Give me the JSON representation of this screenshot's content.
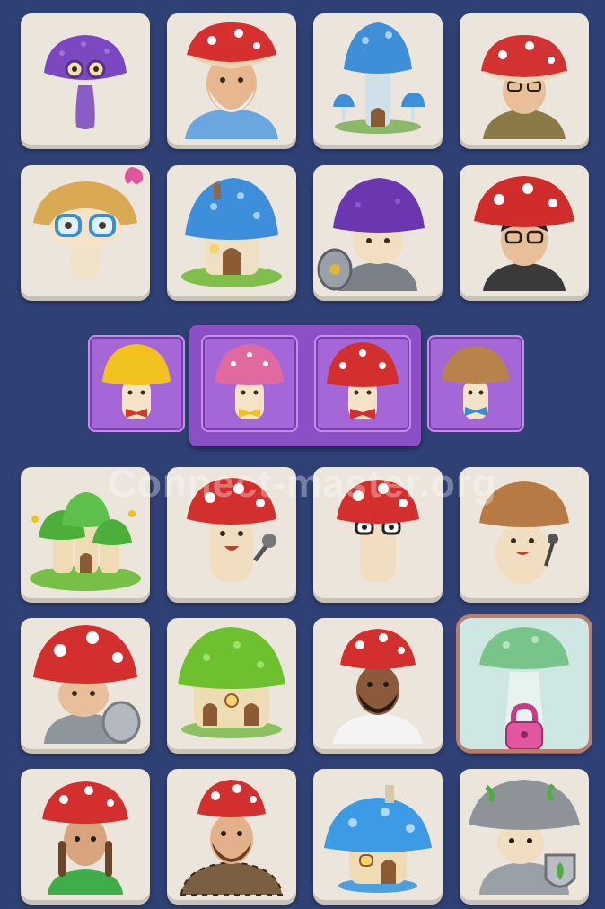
{
  "watermark": "Connect-master.org",
  "tiles": [
    {
      "name": "tile-purple-mushroom-glasses",
      "icon": "purple-mushroom-glasses-icon",
      "locked": false
    },
    {
      "name": "tile-old-man-red-cap",
      "icon": "old-man-red-cap-icon",
      "locked": false
    },
    {
      "name": "tile-blue-mushroom-tower",
      "icon": "blue-mushroom-tower-icon",
      "locked": false
    },
    {
      "name": "tile-man-glasses-red-cap",
      "icon": "man-glasses-red-cap-icon",
      "locked": false
    },
    {
      "name": "tile-tan-mushroom-blue-glasses",
      "icon": "tan-mushroom-blue-glasses-icon",
      "locked": false
    },
    {
      "name": "tile-blue-mushroom-house",
      "icon": "blue-mushroom-house-icon",
      "locked": false
    },
    {
      "name": "tile-purple-knight-mushroom",
      "icon": "purple-knight-mushroom-icon",
      "locked": false
    },
    {
      "name": "tile-man-glasses-red-cap-2",
      "icon": "man-glasses-red-cap-icon",
      "locked": false
    },
    {
      "name": "tile-green-mushroom-village",
      "icon": "green-mushroom-village-icon",
      "locked": false
    },
    {
      "name": "tile-red-mushroom-singer",
      "icon": "red-mushroom-singer-icon",
      "locked": false
    },
    {
      "name": "tile-red-mushroom-glasses",
      "icon": "red-mushroom-glasses-icon",
      "locked": false
    },
    {
      "name": "tile-tan-mushroom-singer",
      "icon": "tan-mushroom-singer-icon",
      "locked": false
    },
    {
      "name": "tile-red-knight-mushroom",
      "icon": "red-knight-mushroom-icon",
      "locked": false
    },
    {
      "name": "tile-green-mushroom-house",
      "icon": "green-mushroom-house-icon",
      "locked": false
    },
    {
      "name": "tile-bearded-man-red-cap",
      "icon": "bearded-man-red-cap-icon",
      "locked": false
    },
    {
      "name": "tile-ghost-mushroom-locked",
      "icon": "ghost-mushroom-icon",
      "locked": true
    },
    {
      "name": "tile-girl-braids-red-cap",
      "icon": "girl-braids-red-cap-icon",
      "locked": false
    },
    {
      "name": "tile-man-beard-plaid-red-cap",
      "icon": "man-beard-plaid-red-cap-icon",
      "locked": false
    },
    {
      "name": "tile-blue-mushroom-cottage",
      "icon": "blue-mushroom-cottage-icon",
      "locked": false
    },
    {
      "name": "tile-silver-knight-mushroom",
      "icon": "silver-knight-mushroom-icon",
      "locked": false
    }
  ],
  "selection": [
    {
      "name": "slot-yellow-mushroom",
      "icon": "yellow-mushroom-bowtie-icon"
    },
    {
      "name": "slot-pink-mushroom",
      "icon": "pink-mushroom-bowtie-icon"
    },
    {
      "name": "slot-red-mushroom",
      "icon": "red-mushroom-bowtie-icon"
    },
    {
      "name": "slot-brown-mushroom",
      "icon": "brown-mushroom-bowtie-icon"
    }
  ],
  "colors": {
    "background": "#2f4075",
    "tile": "#ebe5dc",
    "selection_bar": "#8d4fc5",
    "lock": "#e0579f"
  }
}
